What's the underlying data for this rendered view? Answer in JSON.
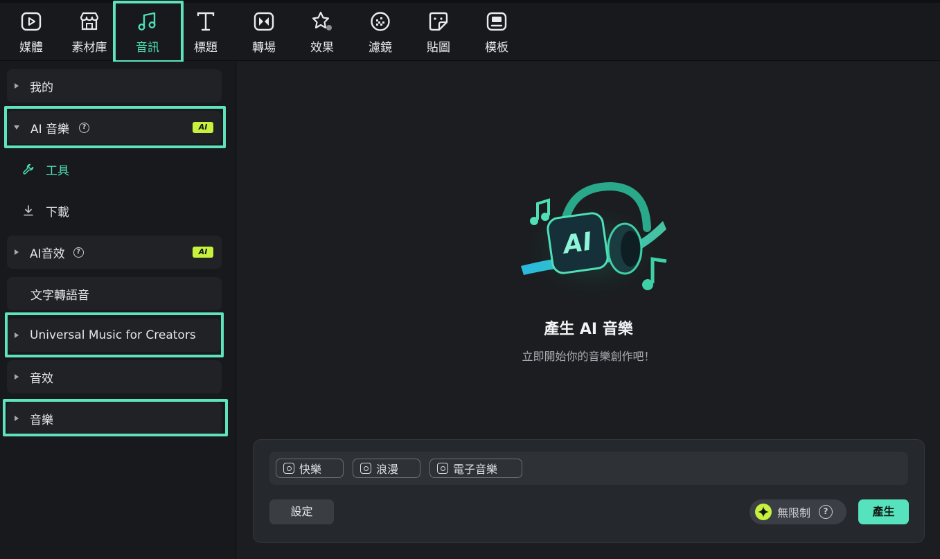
{
  "toolbar": {
    "tabs": [
      {
        "label": "媒體",
        "icon": "media-icon"
      },
      {
        "label": "素材庫",
        "icon": "store-icon"
      },
      {
        "label": "音訊",
        "icon": "music-note-icon",
        "active": true
      },
      {
        "label": "標題",
        "icon": "title-t-icon"
      },
      {
        "label": "轉場",
        "icon": "transition-icon"
      },
      {
        "label": "效果",
        "icon": "effects-star-icon"
      },
      {
        "label": "濾鏡",
        "icon": "filter-icon"
      },
      {
        "label": "貼圖",
        "icon": "sticker-icon"
      },
      {
        "label": "模板",
        "icon": "template-icon"
      }
    ]
  },
  "sidebar": {
    "my": "我的",
    "ai_music": "AI 音樂",
    "ai_badge": "AI",
    "tools": "工具",
    "download": "下載",
    "ai_sfx": "AI音效",
    "tts": "文字轉語音",
    "umc": "Universal Music for Creators",
    "sfx": "音效",
    "music": "音樂"
  },
  "main": {
    "hero_icon_text": "AI",
    "title": "產生 AI 音樂",
    "subtitle": "立即開始你的音樂創作吧！",
    "chips": [
      "快樂",
      "浪漫",
      "電子音樂"
    ],
    "settings_label": "設定",
    "quota_label": "無限制",
    "generate_label": "產生"
  },
  "colors": {
    "accent": "#55e2bc",
    "highlight": "#5ee3bd",
    "ai_badge": "#c6f23e",
    "background": "#17191c"
  }
}
